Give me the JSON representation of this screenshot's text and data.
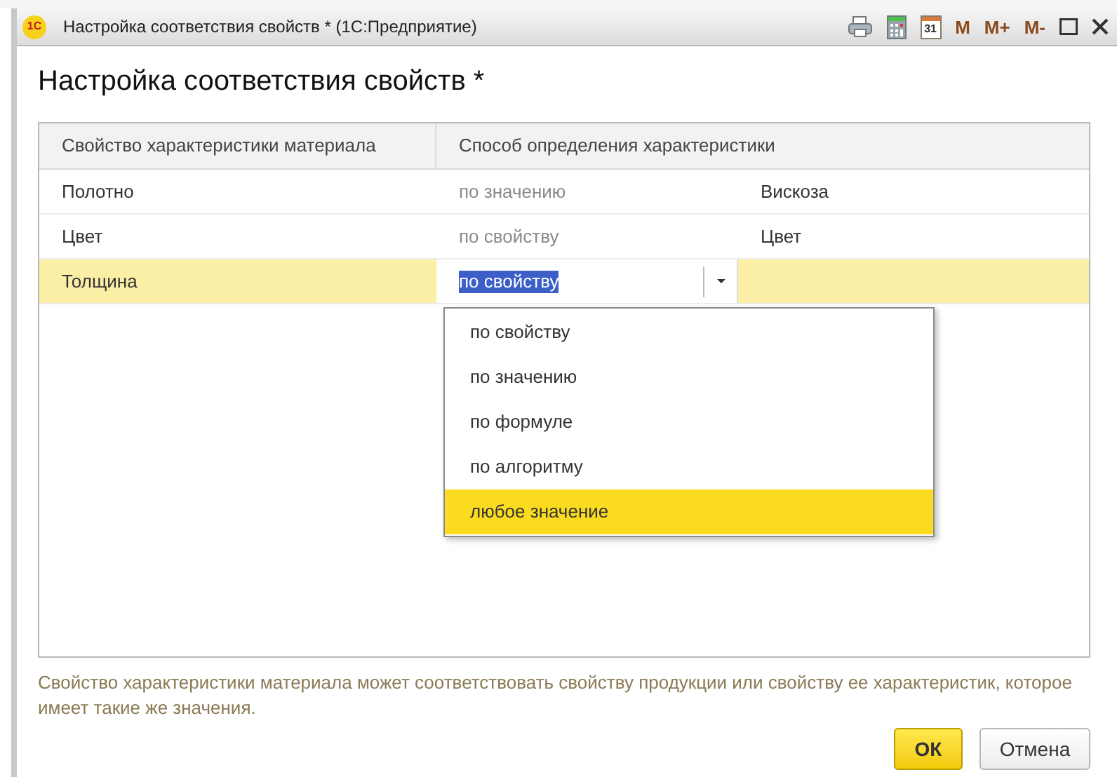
{
  "window": {
    "logo": "1С",
    "title": "Настройка соответствия свойств *  (1С:Предприятие)",
    "toolbar": [
      {
        "kind": "printer"
      },
      {
        "kind": "calculator"
      },
      {
        "kind": "calendar",
        "label": "31"
      },
      {
        "kind": "memory",
        "label": "M"
      },
      {
        "kind": "memory",
        "label": "M+"
      },
      {
        "kind": "memory",
        "label": "M-"
      },
      {
        "kind": "maximize"
      },
      {
        "kind": "close"
      }
    ]
  },
  "heading": "Настройка соответствия свойств *",
  "table": {
    "columns": [
      "Свойство характеристики материала",
      "Способ определения характеристики"
    ],
    "rows": [
      {
        "property": "Полотно",
        "method": "по значению",
        "value": "Вискоза",
        "selected": false
      },
      {
        "property": "Цвет",
        "method": "по свойству",
        "value": "Цвет",
        "selected": false
      },
      {
        "property": "Толщина",
        "method": "по свойству",
        "selected": true
      }
    ]
  },
  "dropdown": {
    "items": [
      {
        "label": "по свойству",
        "selected": false
      },
      {
        "label": "по значению",
        "selected": false
      },
      {
        "label": "по формуле",
        "selected": false
      },
      {
        "label": "по алгоритму",
        "selected": false
      },
      {
        "label": "любое значение",
        "selected": true
      }
    ]
  },
  "hint": "Свойство характеристики материала может соответствовать свойству продукции или свойству ее характеристик, которое имеет такие же значения.",
  "buttons": [
    {
      "label": "ОК",
      "kind": "default"
    },
    {
      "label": "Отмена",
      "kind": "normal"
    }
  ]
}
